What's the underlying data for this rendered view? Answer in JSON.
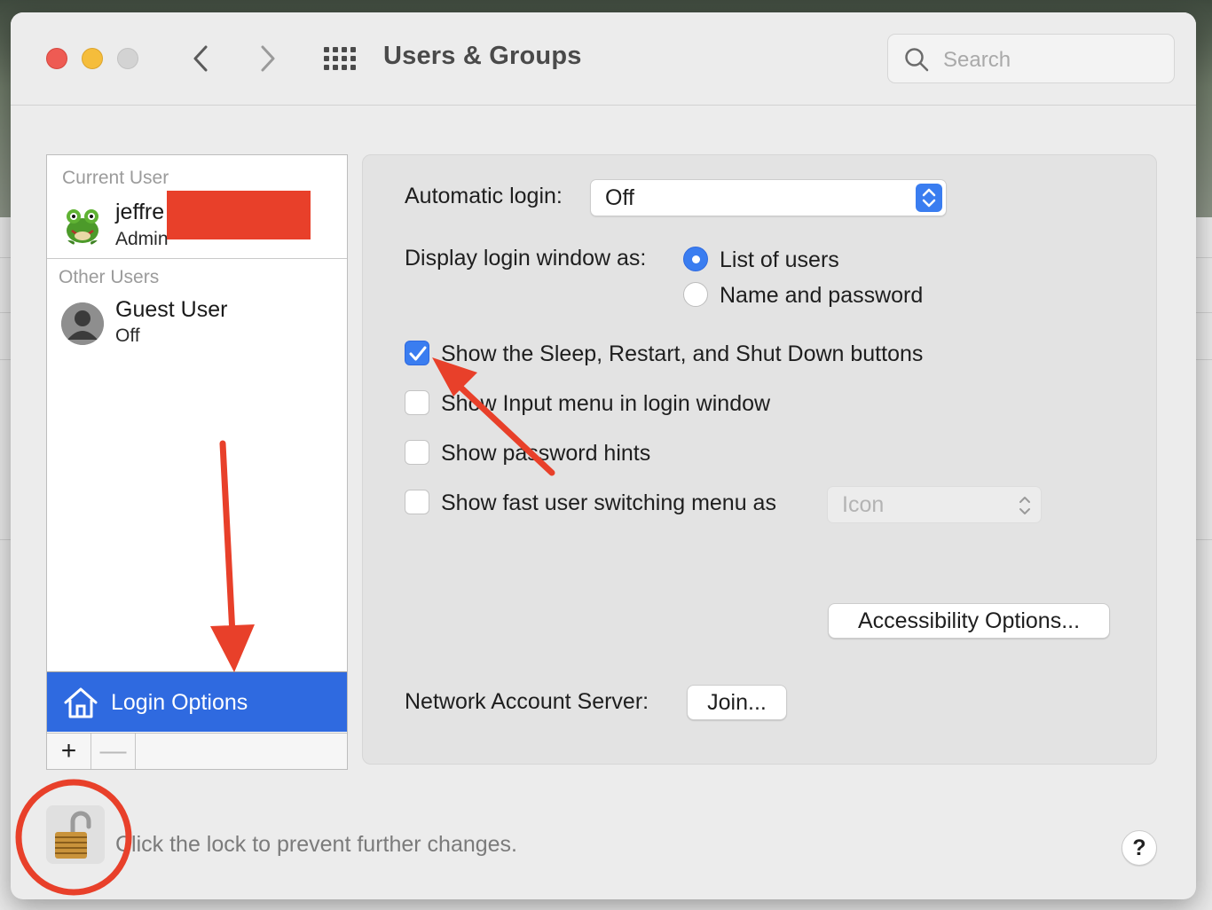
{
  "window": {
    "title": "Users & Groups",
    "search_placeholder": "Search"
  },
  "users": {
    "current_label": "Current User",
    "current_name": "jeffre",
    "current_role": "Admin",
    "other_label": "Other Users",
    "guest_name": "Guest User",
    "guest_status": "Off",
    "login_options": "Login Options",
    "add_symbol": "+",
    "remove_symbol": "—"
  },
  "settings": {
    "automatic_login_label": "Automatic login:",
    "automatic_login_value": "Off",
    "display_login_label": "Display login window as:",
    "radio_list": "List of users",
    "radio_name_password": "Name and password",
    "check_sleep": "Show the Sleep, Restart, and Shut Down buttons",
    "check_input_menu": "Show Input menu in login window",
    "check_password_hints": "Show password hints",
    "check_fast_switching": "Show fast user switching menu as",
    "fast_switching_value": "Icon",
    "accessibility_button": "Accessibility Options...",
    "network_label": "Network Account Server:",
    "join_button": "Join..."
  },
  "footer": {
    "lock_text": "Click the lock to prevent further changes.",
    "help": "?"
  },
  "colors": {
    "accent": "#3a7df0",
    "selection": "#2f6ae0",
    "annotation": "#e8402a"
  },
  "icons": [
    "back-chevron-icon",
    "forward-chevron-icon",
    "grid-icon",
    "search-icon",
    "frog-avatar-icon",
    "guest-avatar-icon",
    "house-icon",
    "lock-icon",
    "checkmark-icon",
    "stepper-icon"
  ]
}
